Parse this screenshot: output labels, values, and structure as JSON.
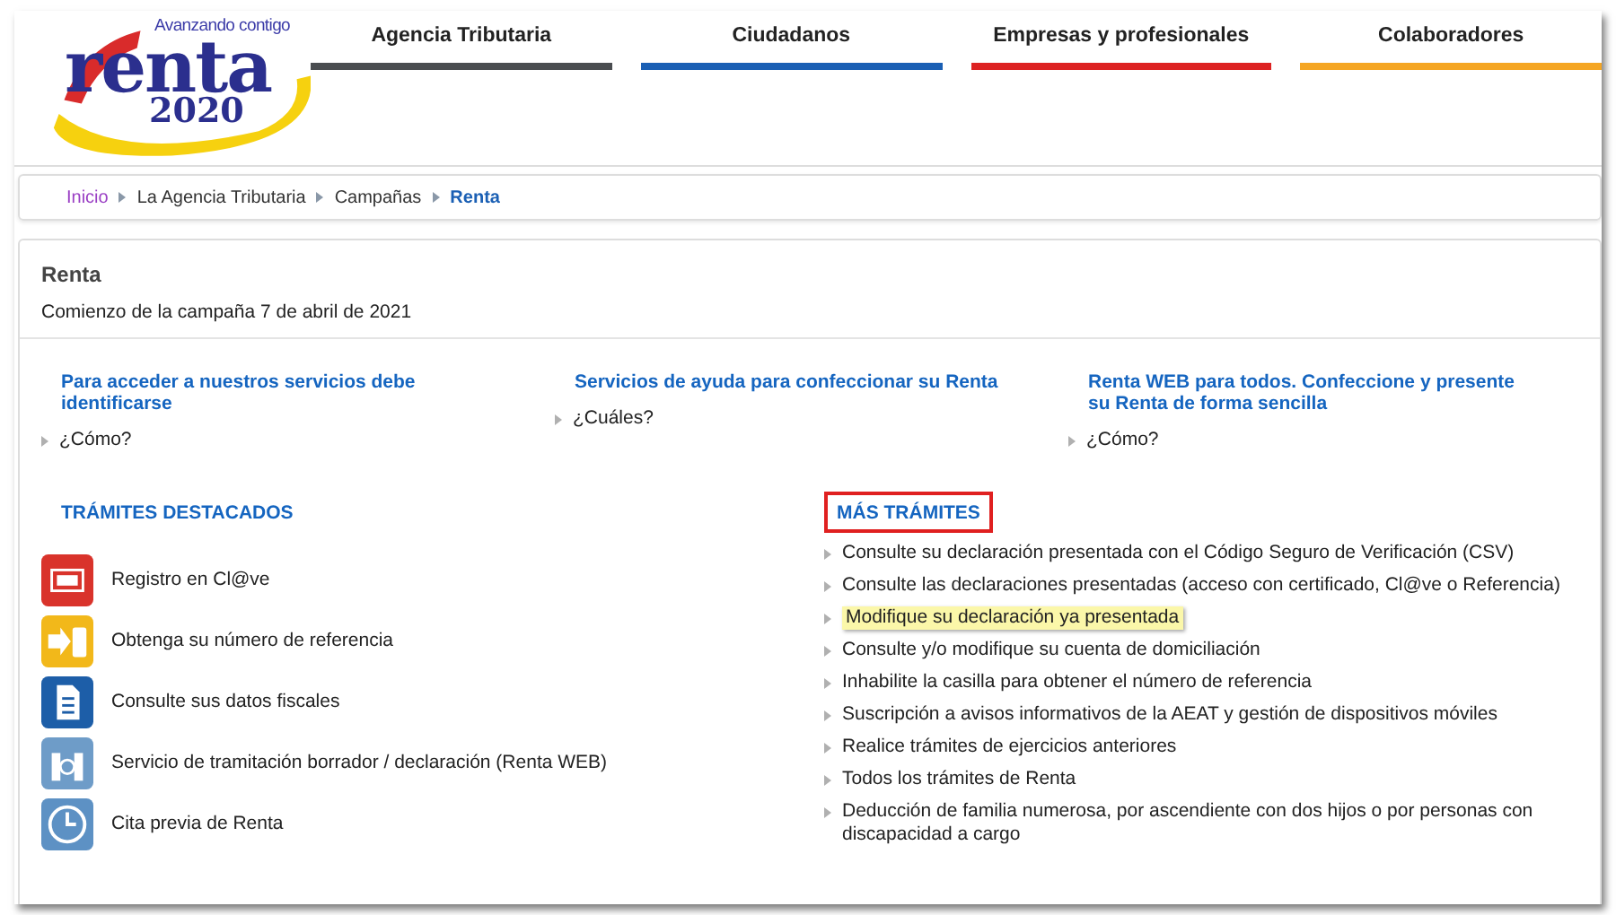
{
  "logo": {
    "tagline": "Avanzando contigo",
    "word": "renta",
    "year": "2020"
  },
  "nav": [
    {
      "label": "Agencia Tributaria",
      "color": "#4a4d50"
    },
    {
      "label": "Ciudadanos",
      "color": "#1a5fb4"
    },
    {
      "label": "Empresas y profesionales",
      "color": "#dd2222"
    },
    {
      "label": "Colaboradores",
      "color": "#f5a623"
    }
  ],
  "breadcrumb": [
    {
      "label": "Inicio",
      "kind": "visited"
    },
    {
      "label": "La Agencia Tributaria",
      "kind": "plain"
    },
    {
      "label": "Campañas",
      "kind": "plain"
    },
    {
      "label": "Renta",
      "kind": "current"
    }
  ],
  "page": {
    "title": "Renta",
    "subtitle": "Comienzo de la campaña 7 de abril de 2021"
  },
  "services": [
    {
      "title": "Para acceder a nuestros servicios debe identificarse",
      "link": "¿Cómo?"
    },
    {
      "title": "Servicios de ayuda para confeccionar su Renta",
      "link": "¿Cuáles?"
    },
    {
      "title": "Renta WEB para todos. Confeccione y presente su Renta de forma sencilla",
      "link": "¿Cómo?"
    }
  ],
  "featured": {
    "heading": "TRÁMITES DESTACADOS",
    "outlined": false,
    "items": [
      {
        "label": "Registro en Cl@ve",
        "kind": "pin"
      },
      {
        "label": "Obtenga su número de referencia",
        "kind": "phone"
      },
      {
        "label": "Consulte sus datos fiscales",
        "kind": "document"
      },
      {
        "label": "Servicio de tramitación borrador / declaración (Renta WEB)",
        "kind": "web"
      },
      {
        "label": "Cita previa de Renta",
        "kind": "clock"
      }
    ]
  },
  "more": {
    "heading": "MÁS TRÁMITES",
    "outlined": true,
    "items": [
      {
        "label": "Consulte su declaración presentada con el Código Seguro de Verificación (CSV)",
        "highlighted": false
      },
      {
        "label": "Consulte las declaraciones presentadas (acceso con certificado, Cl@ve o Referencia)",
        "highlighted": false
      },
      {
        "label": "Modifique su declaración ya presentada",
        "highlighted": true
      },
      {
        "label": "Consulte y/o modifique su cuenta de domiciliación",
        "highlighted": false
      },
      {
        "label": "Inhabilite la casilla para obtener el número de referencia",
        "highlighted": false
      },
      {
        "label": "Suscripción a avisos informativos de la AEAT y gestión de dispositivos móviles",
        "highlighted": false
      },
      {
        "label": "Realice trámites de ejercicios anteriores",
        "highlighted": false
      },
      {
        "label": "Todos los trámites de Renta",
        "highlighted": false
      },
      {
        "label": "Deducción de familia numerosa, por ascendiente con dos hijos o por personas con discapacidad a cargo",
        "highlighted": false
      }
    ]
  }
}
